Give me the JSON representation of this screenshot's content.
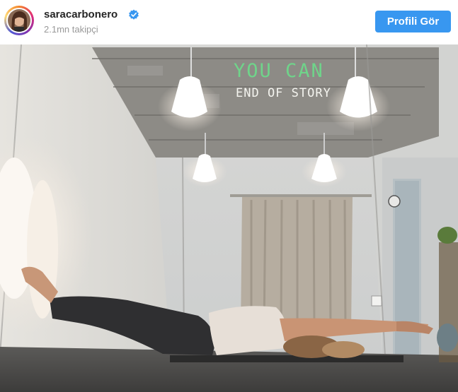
{
  "header": {
    "username": "saracarbonero",
    "verified_icon": "verified-badge-icon",
    "followers": "2.1mn takipçi",
    "profile_button_label": "Profili Gör"
  },
  "photo": {
    "ceiling_text_line1": "YOU CAN",
    "ceiling_text_line2": "END OF STORY"
  },
  "colors": {
    "accent": "#3897f0",
    "username": "#262626",
    "secondary_text": "#999999"
  }
}
